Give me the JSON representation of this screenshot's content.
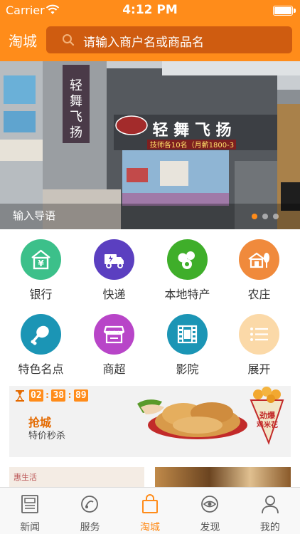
{
  "status_bar": {
    "carrier": "Carrier",
    "time": "4:12 PM"
  },
  "nav": {
    "city": "淘城",
    "search_placeholder": "请输入商户名或商品名"
  },
  "banner": {
    "caption": "输入导语",
    "shop_sign": "轻舞飞扬",
    "shop_subsign": "技师各10名（月薪1800-3",
    "page_count": 3,
    "active_page": 1
  },
  "categories": [
    {
      "label": "银行",
      "icon": "bank-icon",
      "color": "#3cc08a"
    },
    {
      "label": "快递",
      "icon": "delivery-truck-icon",
      "color": "#5b3fc0"
    },
    {
      "label": "本地特产",
      "icon": "local-produce-icon",
      "color": "#3fae2a"
    },
    {
      "label": "农庄",
      "icon": "farmhouse-icon",
      "color": "#f08a3c"
    },
    {
      "label": "特色名点",
      "icon": "chicken-leg-icon",
      "color": "#1b95b5"
    },
    {
      "label": "商超",
      "icon": "storefront-icon",
      "color": "#b845c8"
    },
    {
      "label": "影院",
      "icon": "film-strip-icon",
      "color": "#1b95b5"
    },
    {
      "label": "展开",
      "icon": "list-icon",
      "color": "#fbd9a8"
    }
  ],
  "flash_sale": {
    "timer": [
      "02",
      "38",
      "89"
    ],
    "title": "抢城",
    "subtitle": "特价秒杀"
  },
  "promo_cards": {
    "left_text": "惠生活"
  },
  "tabs": [
    {
      "label": "新闻",
      "icon": "newspaper-icon",
      "active": false
    },
    {
      "label": "服务",
      "icon": "service-icon",
      "active": false
    },
    {
      "label": "淘城",
      "icon": "shopping-bag-icon",
      "active": true
    },
    {
      "label": "发现",
      "icon": "discover-icon",
      "active": false
    },
    {
      "label": "我的",
      "icon": "profile-icon",
      "active": false
    }
  ],
  "colors": {
    "accent": "#ff8c1a",
    "search_bg": "#cf5c10"
  }
}
